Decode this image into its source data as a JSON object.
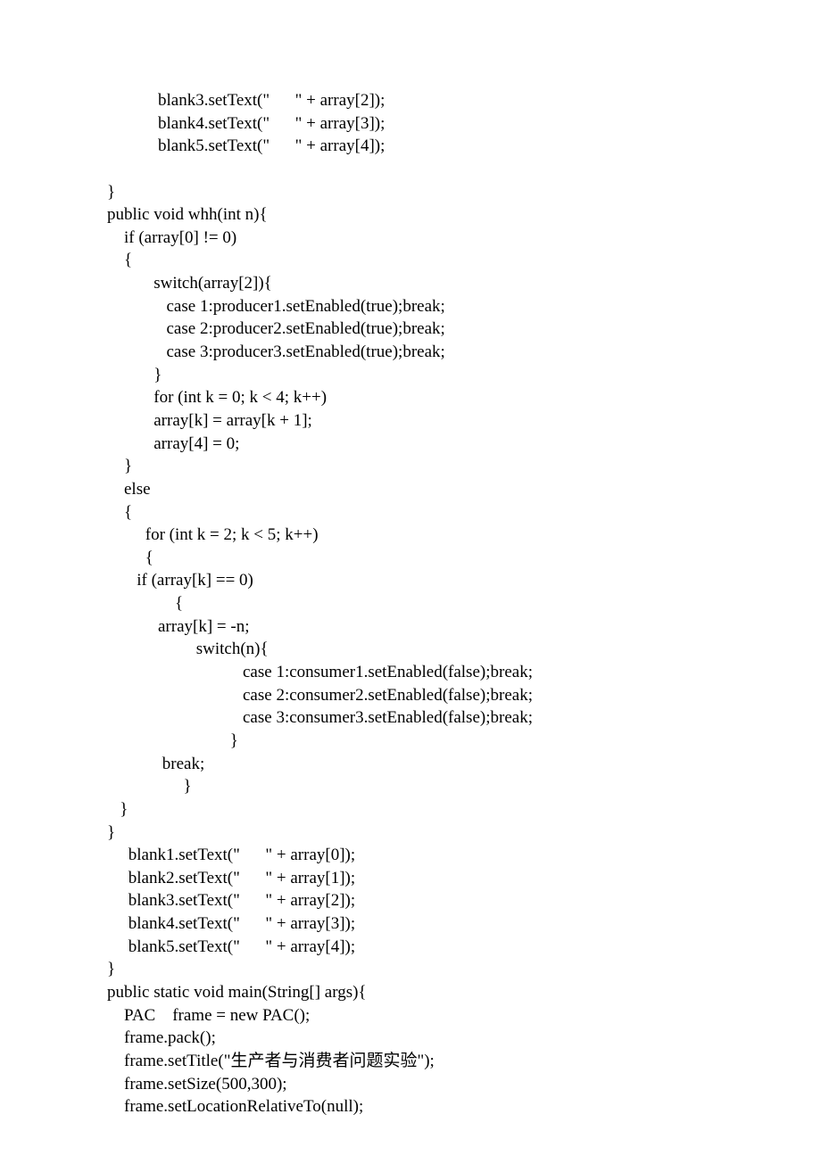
{
  "code": {
    "lines": [
      "            blank3.setText(\"      \" + array[2]);",
      "            blank4.setText(\"      \" + array[3]);",
      "            blank5.setText(\"      \" + array[4]);",
      "",
      "}",
      "public void whh(int n){",
      "    if (array[0] != 0)",
      "    {",
      "           switch(array[2]){",
      "              case 1:producer1.setEnabled(true);break;",
      "              case 2:producer2.setEnabled(true);break;",
      "              case 3:producer3.setEnabled(true);break;",
      "           }",
      "           for (int k = 0; k < 4; k++)",
      "           array[k] = array[k + 1];",
      "           array[4] = 0;",
      "    }",
      "    else",
      "    {",
      "         for (int k = 2; k < 5; k++)",
      "         {",
      "       if (array[k] == 0)",
      "                {",
      "            array[k] = -n;",
      "                     switch(n){",
      "                                case 1:consumer1.setEnabled(false);break;",
      "                                case 2:consumer2.setEnabled(false);break;",
      "                                case 3:consumer3.setEnabled(false);break;",
      "                             }",
      "             break;",
      "                  }",
      "   }",
      "}",
      "     blank1.setText(\"      \" + array[0]);",
      "     blank2.setText(\"      \" + array[1]);",
      "     blank3.setText(\"      \" + array[2]);",
      "     blank4.setText(\"      \" + array[3]);",
      "     blank5.setText(\"      \" + array[4]);",
      "}",
      "public static void main(String[] args){",
      "    PAC    frame = new PAC();",
      "    frame.pack();",
      "    frame.setTitle(\"生产者与消费者问题实验\");",
      "    frame.setSize(500,300);",
      "    frame.setLocationRelativeTo(null);"
    ]
  }
}
